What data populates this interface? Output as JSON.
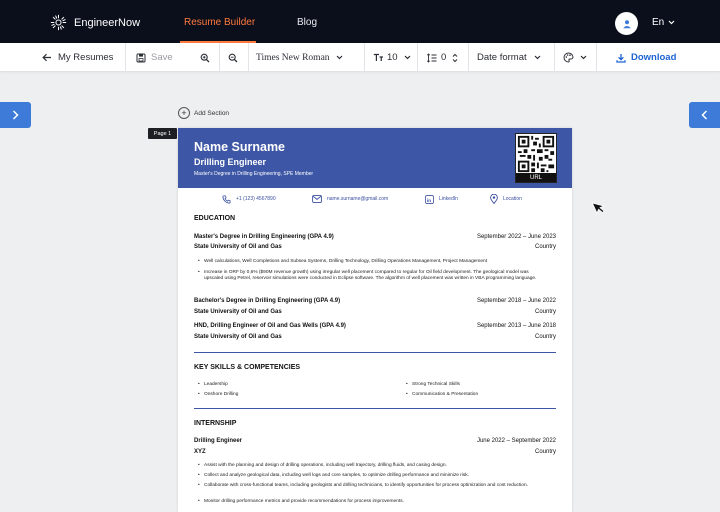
{
  "nav": {
    "brand": "EngineerNow",
    "links": [
      "Resume Builder",
      "Blog"
    ],
    "language": "En"
  },
  "toolbar": {
    "back": "My Resumes",
    "save": "Save",
    "font": "Times New Roman",
    "font_size": "10",
    "spacing": "0",
    "date_format": "Date format",
    "download": "Download"
  },
  "editor": {
    "add_section": "Add Section",
    "page_label": "Page 1"
  },
  "resume": {
    "name": "Name Surname",
    "title": "Drilling Engineer",
    "degree_line": "Master's Degree in Drilling Engineering, SPE Member",
    "qr_label": "URL",
    "contacts": {
      "phone": "+1 (123) 4567890",
      "email": "name.surname@gmail.com",
      "linkedin": "LinkedIn",
      "location": "Location"
    },
    "education": {
      "heading": "EDUCATION",
      "entries": [
        {
          "degree": "Master's Degree in Drilling Engineering (GPA 4.9)",
          "dates": "September 2022 – June 2023",
          "school": "State University of Oil and Gas",
          "location": "Country",
          "bullets": [
            "Well calculations, Well Completions and Subsea Systems, Drilling Technology, Drilling Operations Management, Project Management",
            "Increase in ORF by 0,6% ($90M revenue growth) using irregular well placement compared to regular for Oil field development. The geological model was upscaled using Petrel, reservoir simulations were conducted in Eclipse software. The algorithm of well placement was written in VBA programming language."
          ]
        },
        {
          "degree": "Bachelor's Degree in Drilling Engineering (GPA 4.9)",
          "dates": "September 2018 – June 2022",
          "school": "State University of Oil and Gas",
          "location": "Country"
        },
        {
          "degree": "HND, Drilling Engineer of Oil and Gas Wells (GPA 4.9)",
          "dates": "September 2013 – June 2018",
          "school": "State University of Oil and Gas",
          "location": "Country"
        }
      ]
    },
    "skills": {
      "heading": "KEY SKILLS & COMPETENCIES",
      "items": [
        "Leadership",
        "Strong Technical Skills",
        "Onshore Drilling",
        "Communication & Presentation"
      ]
    },
    "internship": {
      "heading": "INTERNSHIP",
      "role": "Drilling Engineer",
      "dates": "June 2022 – September 2022",
      "company": "XYZ",
      "location": "Country",
      "bullets": [
        "Assist with the planning and design of drilling operations, including well trajectory, drilling fluids, and casing design.",
        "Collect and analyze geological data, including well logs and core samples, to optimize drilling performance and minimize risk.",
        "Collaborate with cross-functional teams, including geologists and drilling technicians, to identify opportunities for process optimization and cost reduction.",
        "Monitor drilling performance metrics and provide recommendations for process improvements."
      ]
    }
  },
  "colors": {
    "nav_bg": "#0b0f1c",
    "accent": "#ff7a3d",
    "primary": "#3d57a6",
    "link_blue": "#1d63d4",
    "side_tab": "#3e7bd9"
  }
}
